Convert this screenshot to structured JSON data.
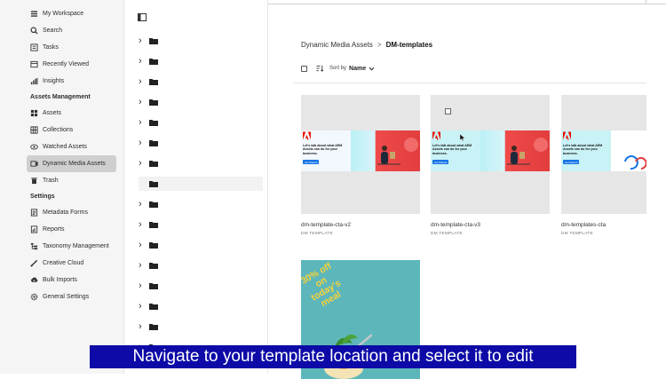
{
  "sidebar": {
    "top_items": [
      {
        "label": "My Workspace",
        "icon": "workspace-icon"
      },
      {
        "label": "Search",
        "icon": "search-icon"
      },
      {
        "label": "Tasks",
        "icon": "tasks-icon"
      },
      {
        "label": "Recently Viewed",
        "icon": "recent-icon"
      },
      {
        "label": "Insights",
        "icon": "insights-icon"
      }
    ],
    "assets_heading": "Assets Management",
    "asset_items": [
      {
        "label": "Assets",
        "icon": "assets-icon"
      },
      {
        "label": "Collections",
        "icon": "collections-icon"
      },
      {
        "label": "Watched Assets",
        "icon": "eye-icon"
      },
      {
        "label": "Dynamic Media Assets",
        "icon": "dynamic-media-icon"
      },
      {
        "label": "Trash",
        "icon": "trash-icon"
      }
    ],
    "settings_heading": "Settings",
    "settings_items": [
      {
        "label": "Metadata Forms",
        "icon": "metadata-icon"
      },
      {
        "label": "Reports",
        "icon": "reports-icon"
      },
      {
        "label": "Taxonomy Management",
        "icon": "taxonomy-icon"
      },
      {
        "label": "Creative Cloud",
        "icon": "creative-cloud-icon"
      },
      {
        "label": "Bulk Imports",
        "icon": "bulk-import-icon"
      },
      {
        "label": "General Settings",
        "icon": "gear-icon"
      }
    ]
  },
  "breadcrumb": {
    "parent": "Dynamic Media Assets",
    "separator": ">",
    "current": "DM-templates"
  },
  "toolbar": {
    "sort_label": "Sort by",
    "sort_value": "Name"
  },
  "cards": [
    {
      "title": "dm-template-cta-v2",
      "type": "DM TEMPLATE",
      "banner_text": "Let's talk about what AEM Assets can do for your business.",
      "banner_cta": "Get Started"
    },
    {
      "title": "dm-template-cta-v3",
      "type": "DM TEMPLATE",
      "banner_text": "Let's talk about what AEM Assets can do for your business.",
      "banner_cta": "Get Started"
    },
    {
      "title": "dm-templates-cta",
      "type": "DM TEMPLATE",
      "banner_text": "Let's talk about what AEM Assets can do for your business.",
      "banner_cta": "Get Started"
    },
    {
      "title": "",
      "type": "",
      "promo_text": "30% off on today's meal"
    }
  ],
  "caption": "Navigate to your template location and select it to edit",
  "colors": {
    "sidebar_bg": "#f5f5f5",
    "active_item_bg": "#cfcfcf",
    "thumb_bg": "#e6e6e6",
    "caption_bg": "#0d0aa7",
    "adobe_red": "#eb1000",
    "promo_teal": "#5db7ba",
    "promo_yellow": "#f7d23b"
  }
}
